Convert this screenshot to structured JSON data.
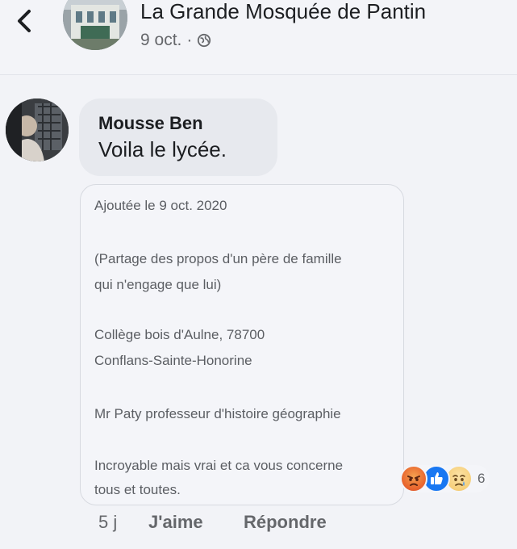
{
  "header": {
    "back_icon": "chevron-left-icon",
    "page_name": "La Grande Mosquée de Pantin",
    "date": "9 oct.",
    "separator": "·",
    "privacy_icon": "globe-icon"
  },
  "comment": {
    "author": "Mousse Ben",
    "text": "Voila le lycée.",
    "attachment": {
      "lines": [
        "Ajoutée le 9 oct. 2020",
        "(Partage des propos d'un père de famille",
        "qui n'engage que lui)",
        "Collège bois d'Aulne, 78700",
        "Conflans-Sainte-Honorine",
        "Mr Paty professeur d'histoire géographie",
        "Incroyable mais vrai et ca vous concerne",
        "tous et toutes."
      ]
    },
    "reactions": {
      "icons": [
        "angry-reaction-icon",
        "like-reaction-icon",
        "sad-reaction-icon"
      ],
      "count": "6"
    },
    "time_ago": "5 j",
    "like_label": "J'aime",
    "reply_label": "Répondre"
  },
  "colors": {
    "background": "#f2f3f7",
    "bubble": "#e7e9ee",
    "secondary_text": "#65676b",
    "like_blue": "#1877f2",
    "angry_orange": "#ea6a30"
  }
}
